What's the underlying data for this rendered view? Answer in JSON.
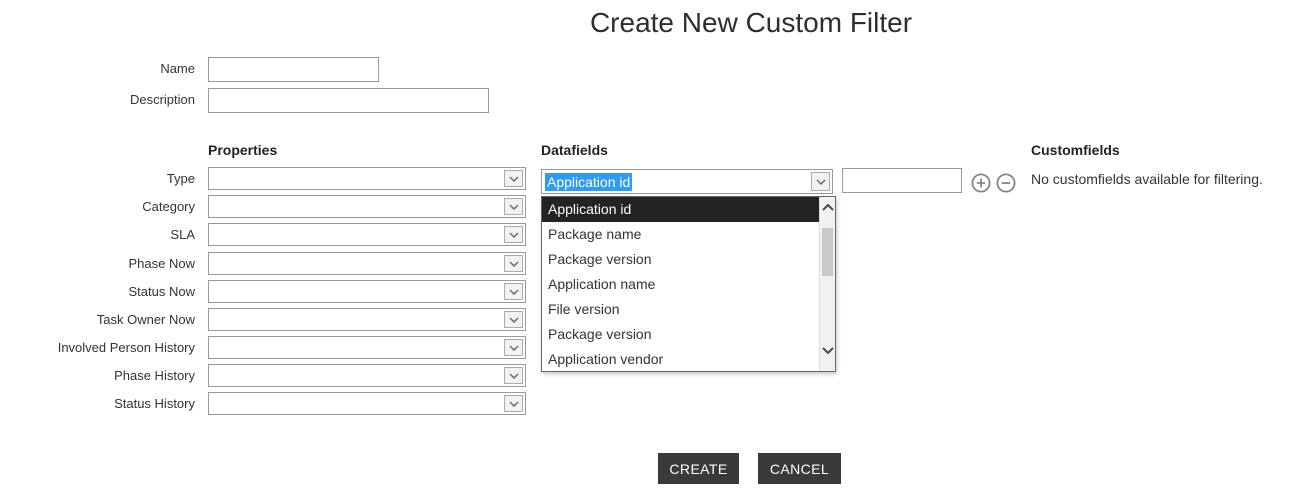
{
  "title": "Create New Custom Filter",
  "form": {
    "name_label": "Name",
    "name_value": "",
    "description_label": "Description",
    "description_value": ""
  },
  "properties": {
    "header": "Properties",
    "rows": [
      {
        "label": "Type",
        "value": ""
      },
      {
        "label": "Category",
        "value": ""
      },
      {
        "label": "SLA",
        "value": ""
      },
      {
        "label": "Phase Now",
        "value": ""
      },
      {
        "label": "Status Now",
        "value": ""
      },
      {
        "label": "Task Owner Now",
        "value": ""
      },
      {
        "label": "Involved Person History",
        "value": ""
      },
      {
        "label": "Phase History",
        "value": ""
      },
      {
        "label": "Status History",
        "value": ""
      }
    ]
  },
  "datafields": {
    "header": "Datafields",
    "select_value": "Application id",
    "value_input": "",
    "dropdown": {
      "items": [
        "Application id",
        "Package name",
        "Package version",
        "Application name",
        "File version",
        "Package version",
        "Application vendor"
      ],
      "selected_index": 0
    }
  },
  "customfields": {
    "header": "Customfields",
    "empty_message": "No customfields available for filtering."
  },
  "actions": {
    "create_label": "CREATE",
    "cancel_label": "CANCEL"
  },
  "icons": {
    "select_arrow": "chevron-down",
    "scroll_up": "chevron-up",
    "scroll_down": "chevron-down",
    "add": "plus-circle",
    "remove": "minus-circle"
  },
  "colors": {
    "selection_blue": "#2e9cf2",
    "dropdown_selected_bg": "#232323",
    "button_bg": "#3a3a3a",
    "border": "#999999"
  }
}
